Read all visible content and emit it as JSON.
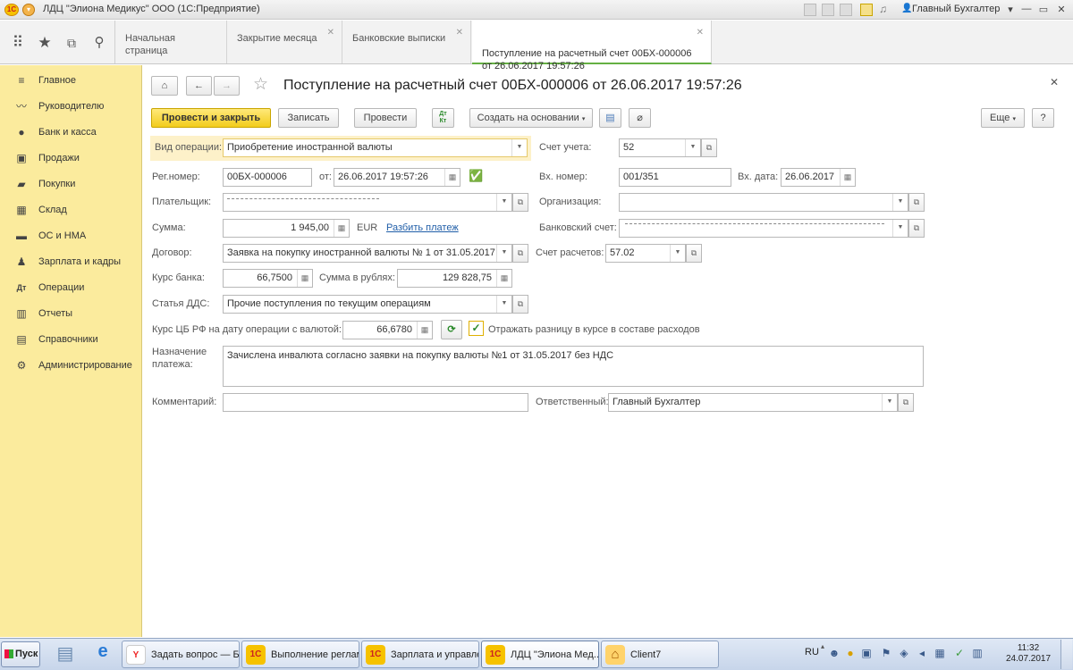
{
  "window": {
    "title": "ЛДЦ \"Элиона Медикус\" ООО  (1С:Предприятие)",
    "user": "Главный Бухгалтер",
    "logo": "1C",
    "controls": [
      "▾",
      "—",
      "▭",
      "✕"
    ]
  },
  "sections_panel": {
    "icons": [
      "apps-grid-icon",
      "star-icon",
      "history-icon",
      "search-icon"
    ]
  },
  "tabs": [
    {
      "label": "Начальная страница",
      "closable": false,
      "active": false
    },
    {
      "label": "Закрытие месяца",
      "closable": true,
      "active": false
    },
    {
      "label": "Банковские выписки",
      "closable": true,
      "active": false
    },
    {
      "label": "Поступление на расчетный счет 00БХ-000006\nот 26.06.2017 19:57:26",
      "closable": true,
      "active": true
    }
  ],
  "sidebar": {
    "items": [
      {
        "label": "Главное",
        "icon": "menu-icon"
      },
      {
        "label": "Руководителю",
        "icon": "chart-line-icon"
      },
      {
        "label": "Банк и касса",
        "icon": "coin-icon"
      },
      {
        "label": "Продажи",
        "icon": "shopping-bag-icon"
      },
      {
        "label": "Покупки",
        "icon": "cart-icon"
      },
      {
        "label": "Склад",
        "icon": "warehouse-icon"
      },
      {
        "label": "ОС и НМА",
        "icon": "car-icon"
      },
      {
        "label": "Зарплата и кадры",
        "icon": "people-icon"
      },
      {
        "label": "Операции",
        "icon": "operations-icon"
      },
      {
        "label": "Отчеты",
        "icon": "bar-chart-icon"
      },
      {
        "label": "Справочники",
        "icon": "book-icon"
      },
      {
        "label": "Администрирование",
        "icon": "gear-icon"
      }
    ]
  },
  "document": {
    "title": "Поступление на расчетный счет 00БХ-000006 от 26.06.2017 19:57:26",
    "toolbar": {
      "post_close": "Провести и закрыть",
      "save": "Записать",
      "post": "Провести",
      "dt_kt": "Дт\nКт",
      "create_based": "Создать на основании",
      "more": "Еще",
      "help": "?"
    },
    "fields": {
      "operation_type": {
        "label": "Вид операции:",
        "value": "Приобретение иностранной валюты"
      },
      "reg_number": {
        "label": "Рег.номер:",
        "value": "00БХ-000006"
      },
      "date_from": {
        "label": "от:",
        "value": "26.06.2017 19:57:26"
      },
      "payer": {
        "label": "Плательщик:",
        "value": ""
      },
      "amount": {
        "label": "Сумма:",
        "value": "1 945,00",
        "currency": "EUR",
        "split_link": "Разбить платеж"
      },
      "contract": {
        "label": "Договор:",
        "value": "Заявка на покупку иностранной валюты № 1 от 31.05.2017"
      },
      "bank_rate": {
        "label": "Курс банка:",
        "value": "66,7500"
      },
      "amount_rub": {
        "label": "Сумма в рублях:",
        "value": "129 828,75"
      },
      "cash_flow": {
        "label": "Статья ДДС:",
        "value": "Прочие поступления по текущим операциям"
      },
      "cb_rate": {
        "label": "Курс ЦБ РФ на дату операции с валютой:",
        "value": "66,6780"
      },
      "reflect_diff": {
        "label": "Отражать разницу в курсе в составе расходов",
        "checked": true
      },
      "purpose": {
        "label": "Назначение\nплатежа:",
        "value": "Зачислена инвалюта согласно заявки на покупку валюты №1 от 31.05.2017 без НДС"
      },
      "comment": {
        "label": "Комментарий:",
        "value": ""
      },
      "account": {
        "label": "Счет учета:",
        "value": "52"
      },
      "in_number": {
        "label": "Вх. номер:",
        "value": "001/351"
      },
      "in_date": {
        "label": "Вх. дата:",
        "value": "26.06.2017"
      },
      "organization": {
        "label": "Организация:",
        "value": ""
      },
      "bank_account": {
        "label": "Банковский счет:",
        "value": ""
      },
      "settlement_account": {
        "label": "Счет расчетов:",
        "value": "57.02"
      },
      "responsible": {
        "label": "Ответственный:",
        "value": "Главный Бухгалтер"
      }
    }
  },
  "taskbar": {
    "start": "Пуск",
    "tasks": [
      {
        "label": "Задать вопрос — Бу...",
        "icon": "Y",
        "active": false
      },
      {
        "label": "Выполнение реглам...",
        "icon": "1С",
        "active": false
      },
      {
        "label": "Зарплата и управле...",
        "icon": "1С",
        "active": false
      },
      {
        "label": "ЛДЦ \"Элиона Мед...",
        "icon": "1С",
        "active": true
      },
      {
        "label": "Client7",
        "icon": "⌂",
        "active": false
      }
    ],
    "language": "RU",
    "time": "11:32",
    "date": "24.07.2017"
  }
}
